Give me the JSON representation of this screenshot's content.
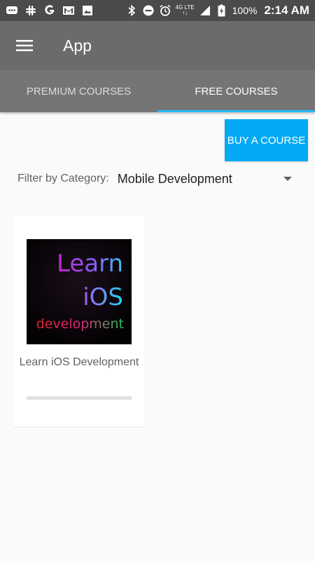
{
  "status_bar": {
    "battery_text": "100%",
    "time": "2:14 AM",
    "network_top": "4G LTE",
    "network_bottom": "↑↓"
  },
  "app_bar": {
    "menu_icon": "hamburger-menu-icon",
    "title": "App"
  },
  "tabs": [
    {
      "label": "PREMIUM COURSES",
      "active": false
    },
    {
      "label": "FREE COURSES",
      "active": true
    }
  ],
  "buy_button": {
    "label": "BUY A COURSE"
  },
  "filter": {
    "label": "Filter by Category:",
    "selected": "Mobile Development",
    "icon": "dropdown-arrow-icon"
  },
  "courses": [
    {
      "title": "Learn iOS Development",
      "thumbnail_lines": [
        "Learn",
        "iOS",
        "development"
      ],
      "progress": 0
    }
  ],
  "colors": {
    "status_bar": "#4b4b4b",
    "app_bar": "#6b6b6b",
    "tabs": "#757575",
    "tab_indicator": "#29b6f6",
    "accent": "#03a9f4",
    "background": "#fafafa"
  }
}
